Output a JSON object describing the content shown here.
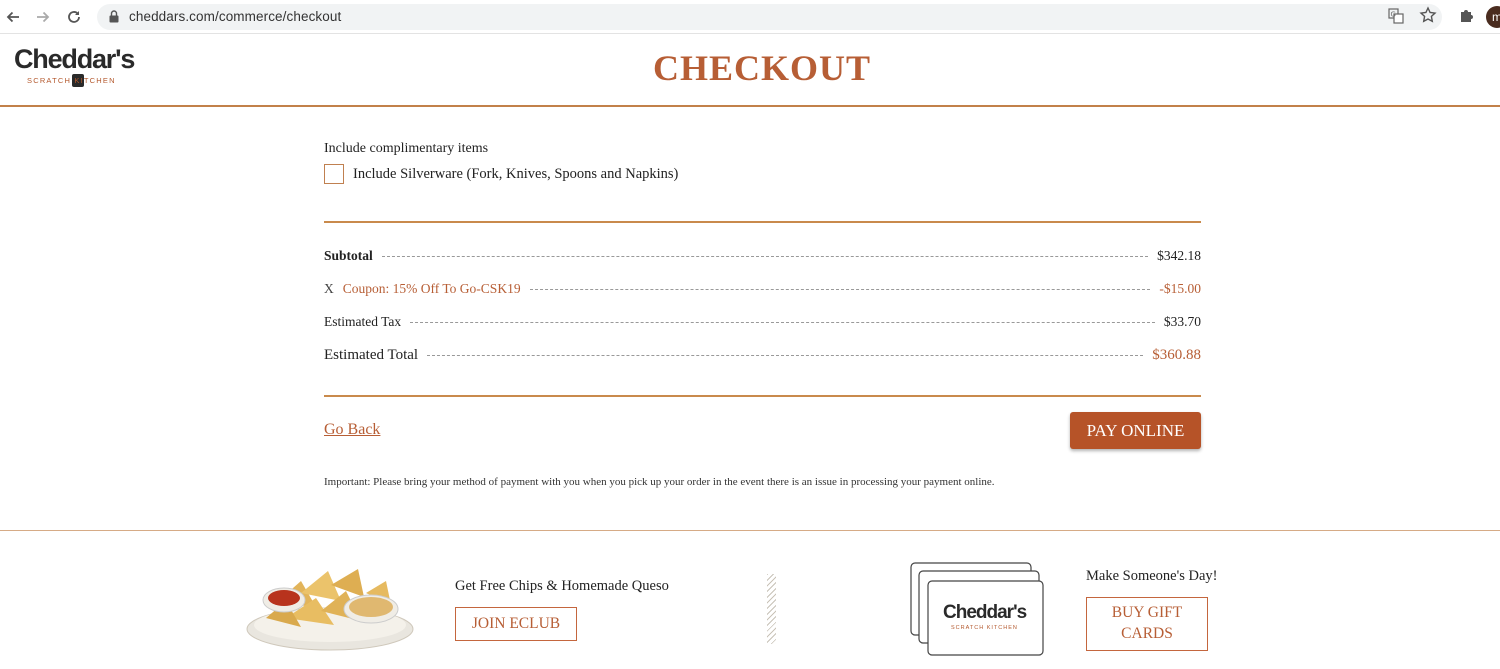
{
  "browser": {
    "url": "cheddars.com/commerce/checkout",
    "profile_initial": "m"
  },
  "header": {
    "logo_text": "Cheddar's",
    "logo_subtext": "SCRATCH KITCHEN",
    "title": "CHECKOUT"
  },
  "complimentary": {
    "heading": "Include complimentary items",
    "silverware_label": "Include Silverware (Fork, Knives, Spoons and Napkins)",
    "silverware_checked": false
  },
  "summary": {
    "subtotal_label": "Subtotal",
    "subtotal_value": "$342.18",
    "coupon_remove": "X",
    "coupon_label": "Coupon: 15% Off To Go-CSK19",
    "coupon_value": "-$15.00",
    "tax_label": "Estimated Tax",
    "tax_value": "$33.70",
    "total_label": "Estimated Total",
    "total_value": "$360.88"
  },
  "actions": {
    "go_back": "Go Back",
    "pay_online": "PAY ONLINE"
  },
  "notice": "Important: Please bring your method of payment with you when you pick up your order in the event there is an issue in processing your payment online.",
  "footer": {
    "eclub_text": "Get Free Chips & Homemade Queso",
    "eclub_button": "JOIN ECLUB",
    "gift_text": "Make Someone's Day!",
    "gift_button": "BUY GIFT CARDS",
    "gift_card_logo": "Cheddar's",
    "gift_card_sub": "SCRATCH KITCHEN"
  },
  "colors": {
    "accent": "#b75e35",
    "button": "#b65328",
    "rule": "#c98a4c"
  }
}
